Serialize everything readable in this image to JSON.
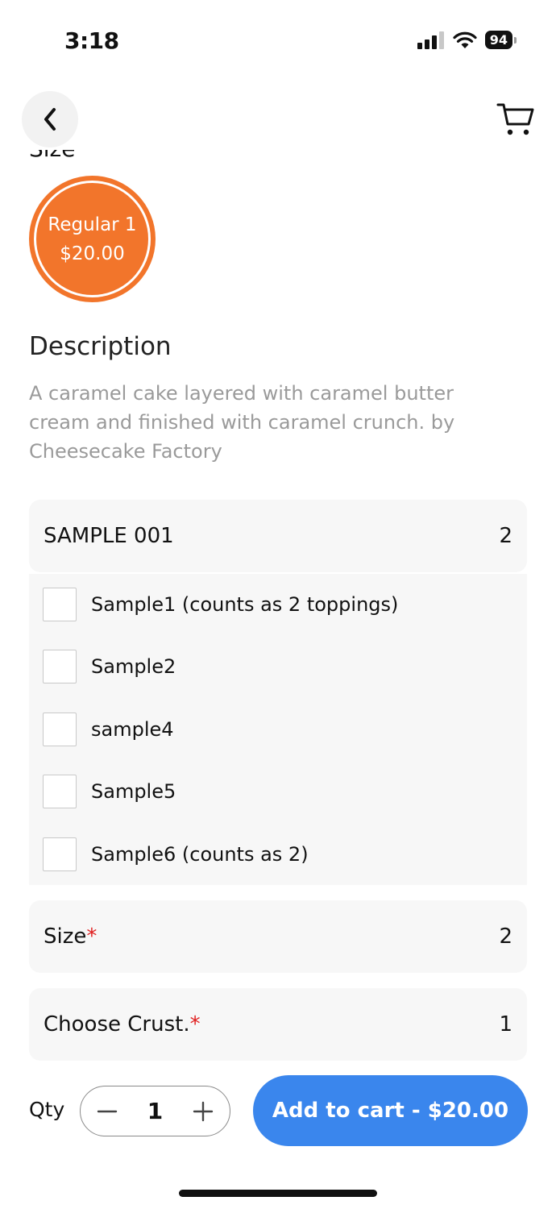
{
  "status_bar": {
    "time": "3:18",
    "battery": "94"
  },
  "icons": {
    "back": "chevron-left-icon",
    "cart": "cart-icon"
  },
  "size_section": {
    "heading_partial": "Size",
    "option": {
      "name": "Regular 1",
      "price": "$20.00",
      "selected": true
    }
  },
  "description": {
    "title": "Description",
    "text": "A caramel cake layered with caramel butter cream and finished with caramel crunch. by Cheesecake Factory"
  },
  "groups": [
    {
      "title": "SAMPLE 001",
      "count": "2",
      "required": false,
      "options": [
        {
          "label": "Sample1 (counts as 2 toppings)",
          "checked": false
        },
        {
          "label": "Sample2",
          "checked": false
        },
        {
          "label": "sample4",
          "checked": false
        },
        {
          "label": "Sample5",
          "checked": false
        },
        {
          "label": "Sample6 (counts as 2)",
          "checked": false
        }
      ]
    },
    {
      "title": "Size",
      "required_mark": "*",
      "count": "2",
      "required": true
    },
    {
      "title": "Choose Crust.",
      "required_mark": "*",
      "count": "1",
      "required": true
    }
  ],
  "footer": {
    "qty_label": "Qty",
    "qty_value": "1",
    "add_to_cart": "Add to cart - $20.00"
  },
  "colors": {
    "accent_orange": "#f2752b",
    "primary_blue": "#3a86ed",
    "required_red": "#e02020",
    "panel_gray": "#f7f7f7"
  }
}
